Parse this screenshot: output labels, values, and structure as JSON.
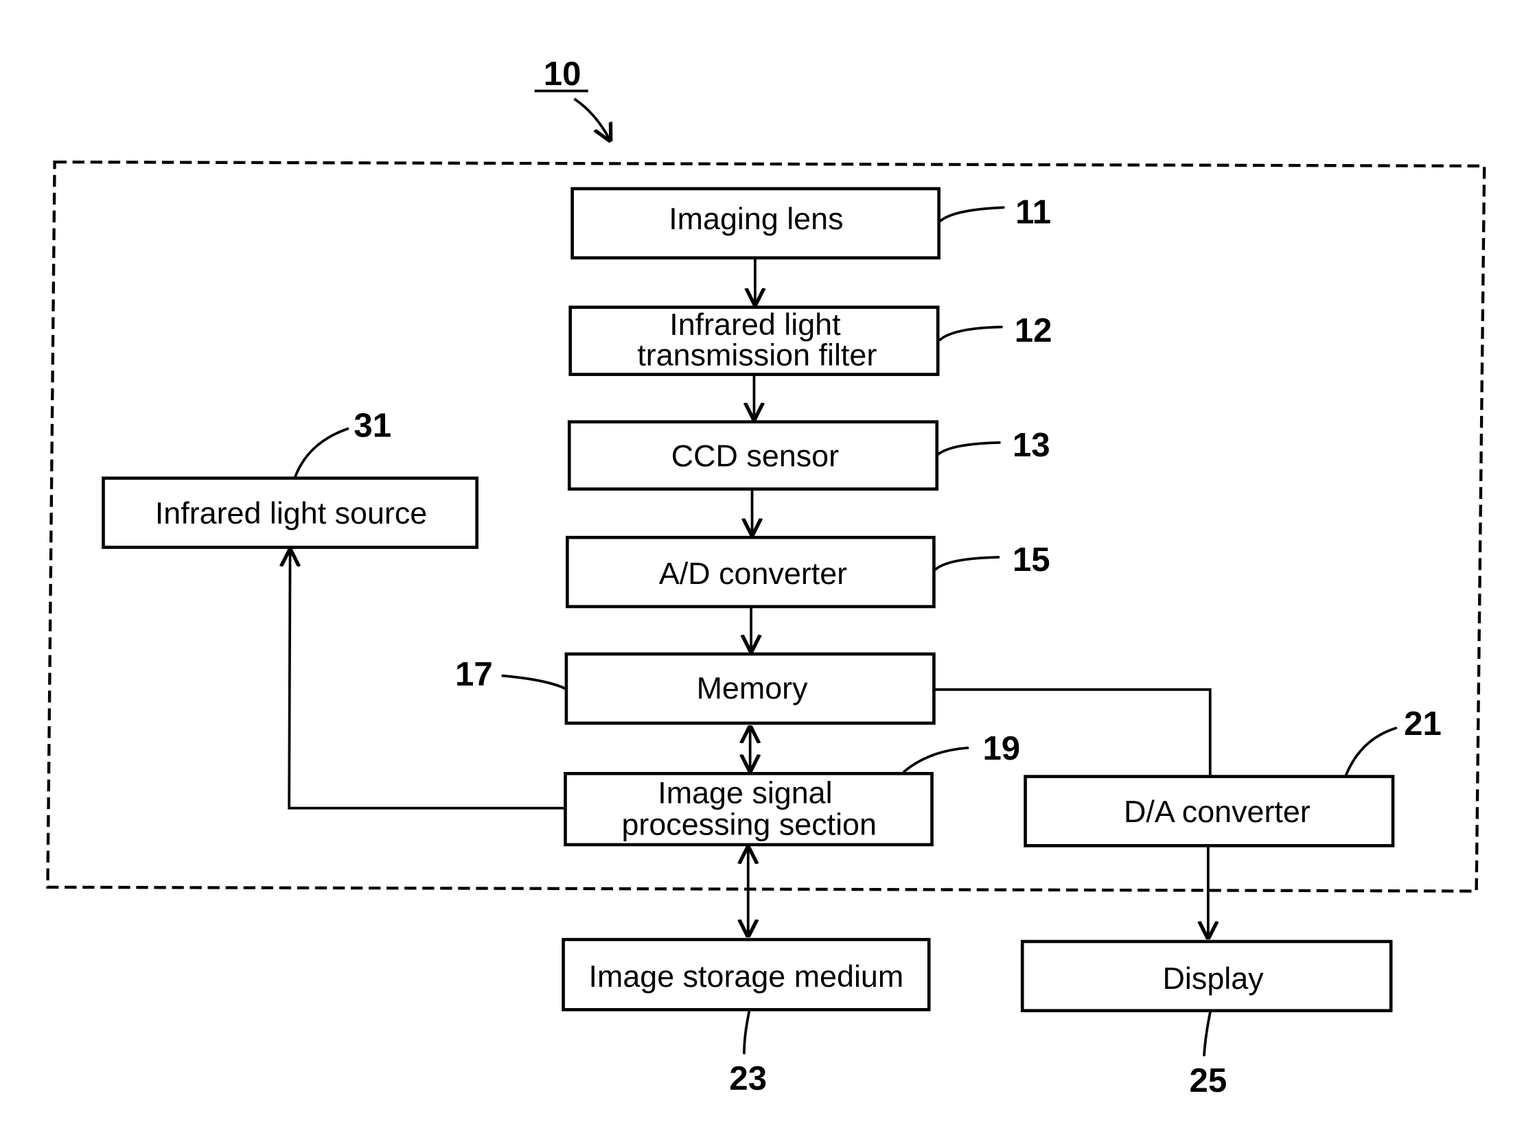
{
  "figure": {
    "reference": "10",
    "blocks": {
      "imaging_lens": {
        "label": "Imaging lens",
        "ref": "11"
      },
      "ir_filter": {
        "line1": "Infrared light",
        "line2": "transmission filter",
        "ref": "12"
      },
      "ccd_sensor": {
        "label": "CCD sensor",
        "ref": "13"
      },
      "ad_converter": {
        "label": "A/D converter",
        "ref": "15"
      },
      "memory": {
        "label": "Memory",
        "ref": "17"
      },
      "image_signal": {
        "line1": "Image signal",
        "line2": "processing section",
        "ref": "19"
      },
      "da_converter": {
        "label": "D/A converter",
        "ref": "21"
      },
      "storage": {
        "label": "Image storage medium",
        "ref": "23"
      },
      "display": {
        "label": "Display",
        "ref": "25"
      },
      "ir_source": {
        "label": "Infrared light source",
        "ref": "31"
      }
    }
  }
}
